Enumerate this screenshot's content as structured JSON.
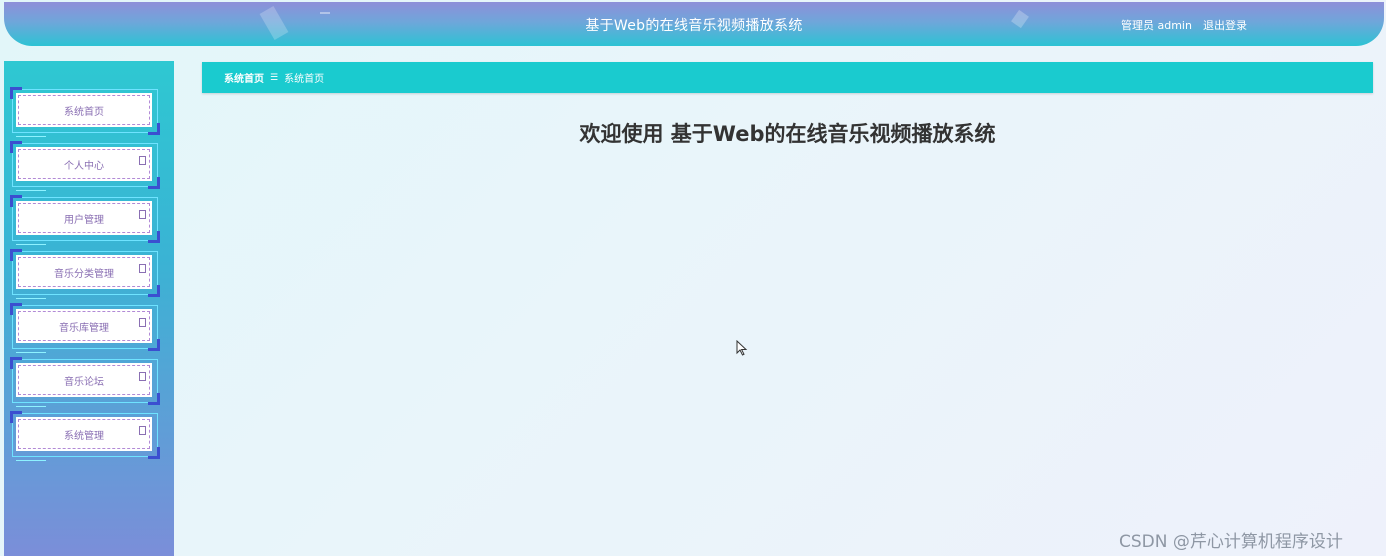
{
  "header": {
    "title": "基于Web的在线音乐视频播放系统",
    "user": "管理员 admin",
    "logout": "退出登录"
  },
  "breadcrumb": {
    "home": "系统首页",
    "separator": "☰",
    "current": "系统首页"
  },
  "sidebar": {
    "items": [
      {
        "label": "系统首页",
        "has_arrow": false
      },
      {
        "label": "个人中心",
        "has_arrow": true
      },
      {
        "label": "用户管理",
        "has_arrow": true
      },
      {
        "label": "音乐分类管理",
        "has_arrow": true
      },
      {
        "label": "音乐库管理",
        "has_arrow": true
      },
      {
        "label": "音乐论坛",
        "has_arrow": true
      },
      {
        "label": "系统管理",
        "has_arrow": true
      }
    ]
  },
  "main": {
    "welcome": "欢迎使用 基于Web的在线音乐视频播放系统"
  },
  "watermark": "CSDN @芹心计算机程序设计",
  "colors": {
    "header_top": "#8e8fd9",
    "header_bottom": "#2cc3d4",
    "breadcrumb_bg": "#1acbcf",
    "sidebar_top": "#2ec8d2",
    "sidebar_bottom": "#7b8ed9",
    "menu_text": "#8a6fb3"
  }
}
